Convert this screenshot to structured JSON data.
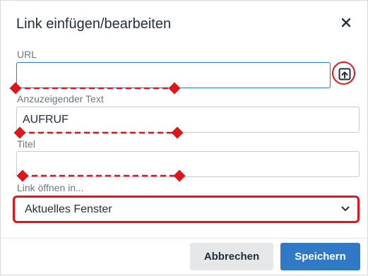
{
  "dialog": {
    "title": "Link einfügen/bearbeiten",
    "close_icon": "close-icon"
  },
  "fields": {
    "url": {
      "label": "URL",
      "value": "",
      "browse_icon": "browse-link-icon"
    },
    "text": {
      "label": "Anzuzeigender Text",
      "value": "AUFRUF"
    },
    "title": {
      "label": "Titel",
      "value": ""
    },
    "target": {
      "label": "Link öffnen in...",
      "value": "Aktuelles Fenster"
    }
  },
  "footer": {
    "cancel_label": "Abbrechen",
    "save_label": "Speichern"
  },
  "colors": {
    "accent": "#2f79c7",
    "annotation_red": "#e0141b",
    "text": "#222f3e",
    "label": "#6e7682"
  }
}
